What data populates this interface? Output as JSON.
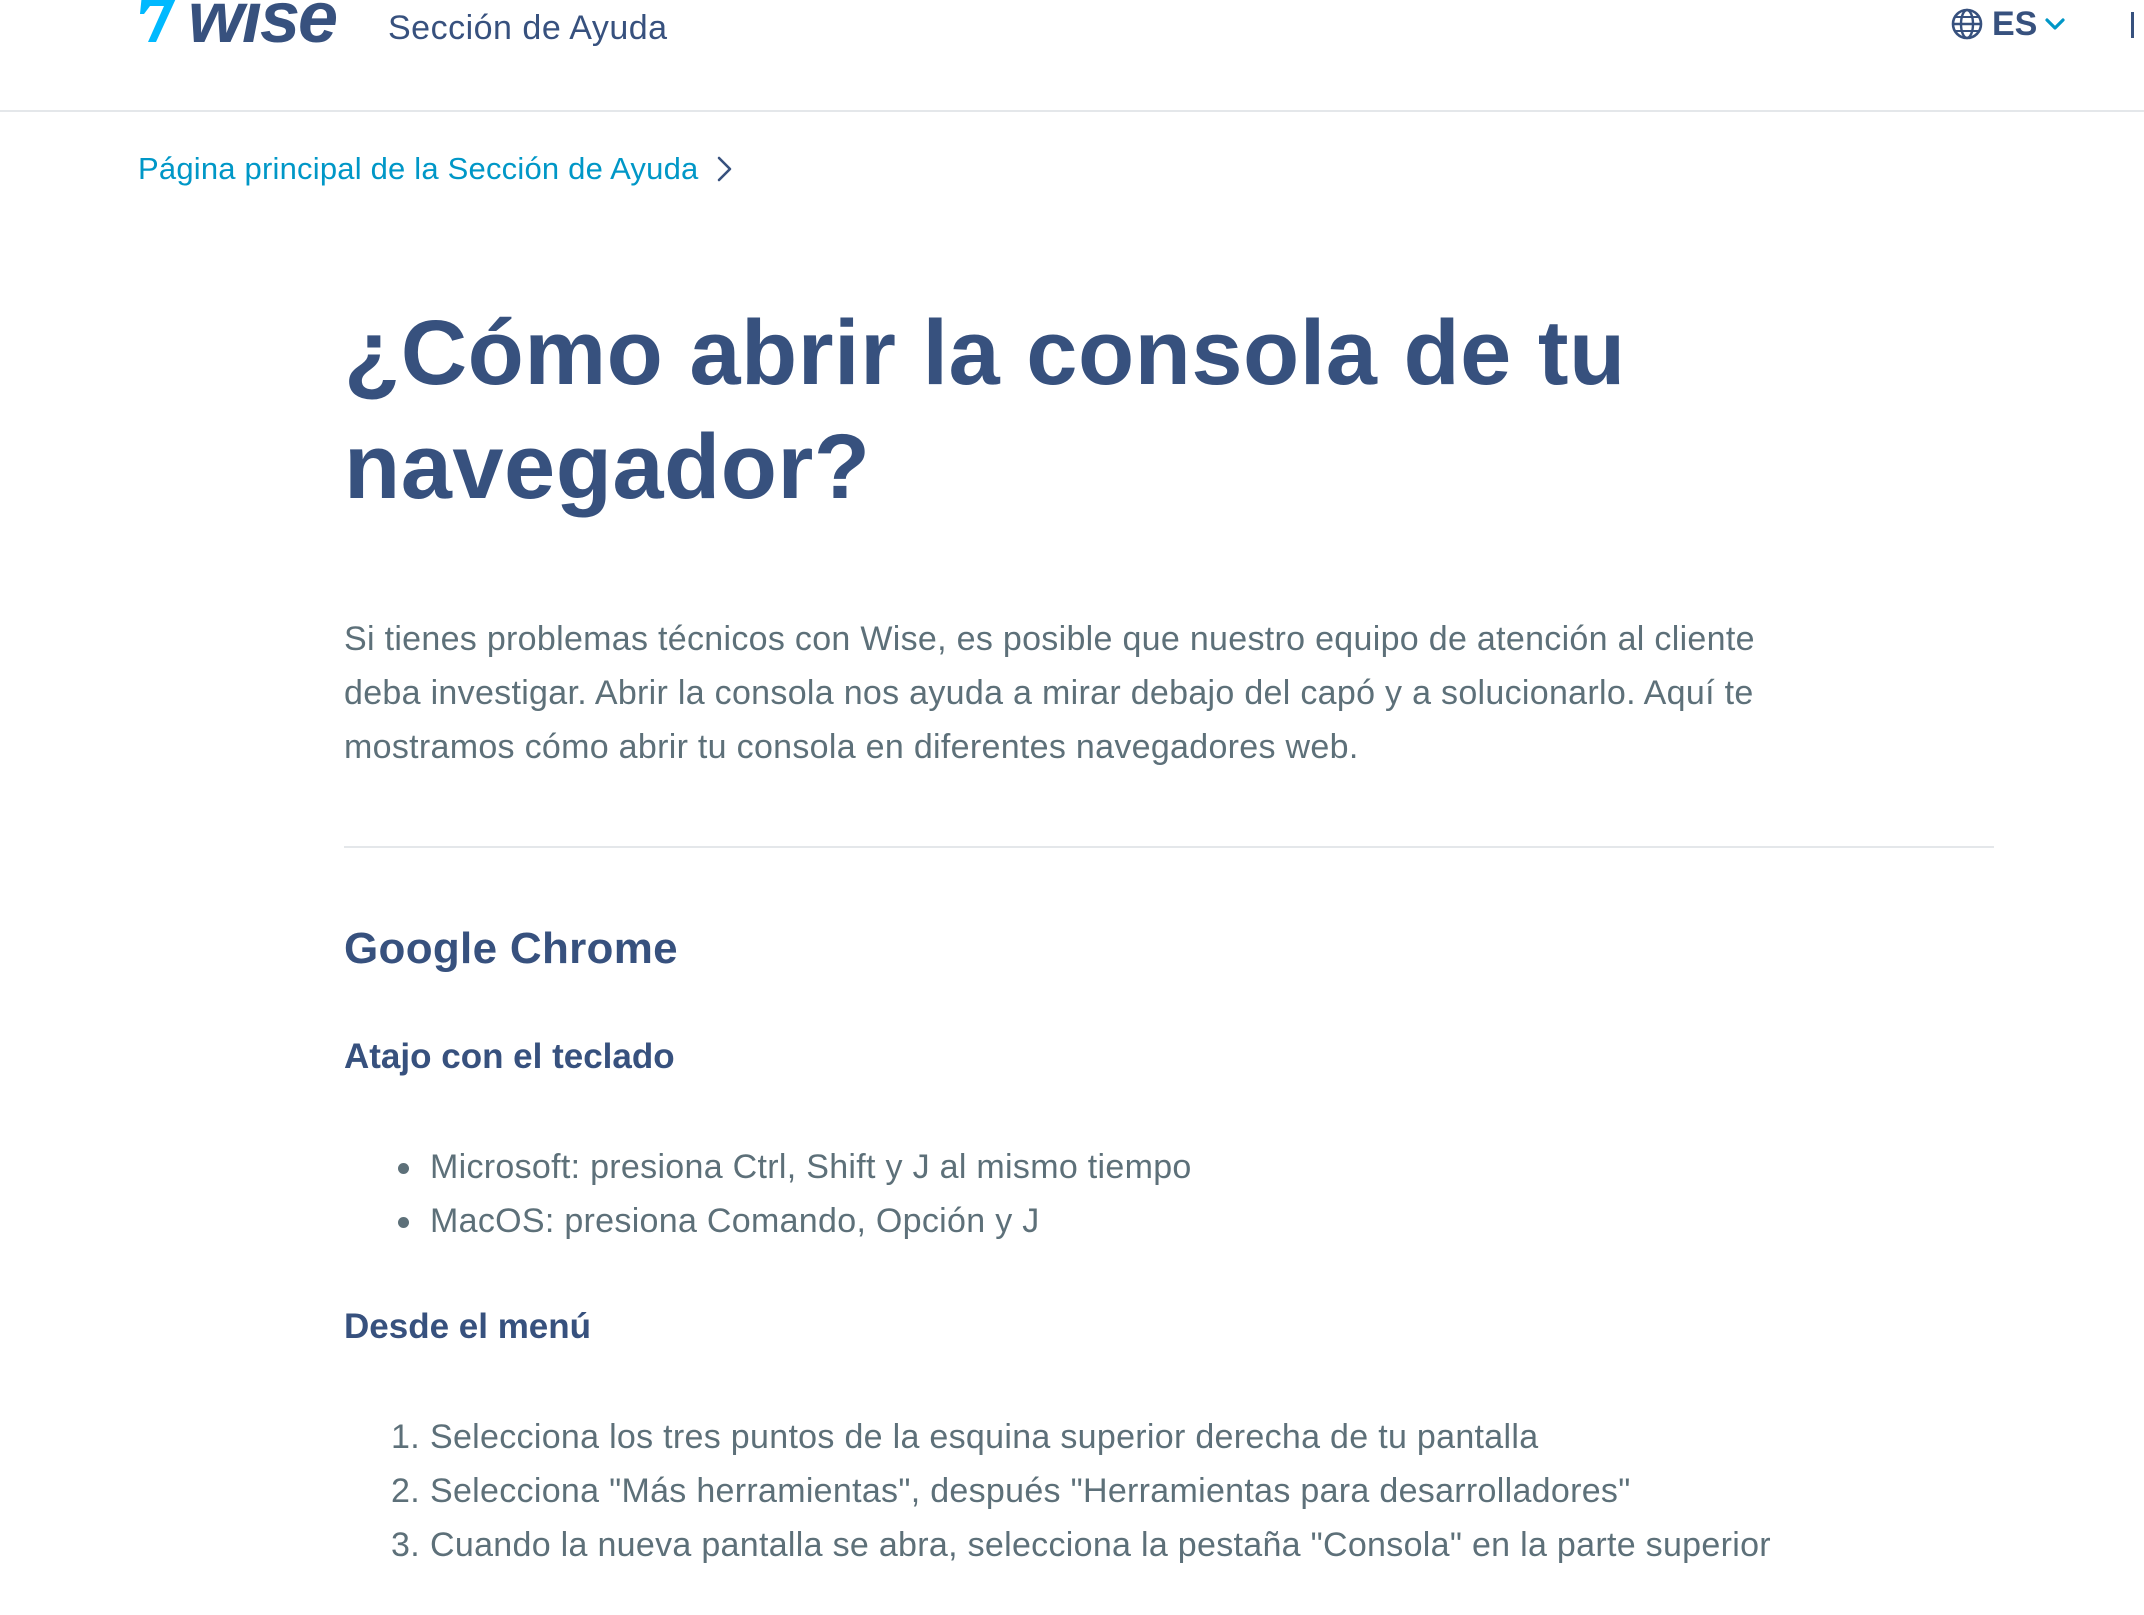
{
  "header": {
    "logo_text": "wise",
    "help_title": "Sección de Ayuda",
    "language": "ES"
  },
  "breadcrumb": {
    "link": "Página principal de la Sección de Ayuda"
  },
  "article": {
    "title": "¿Cómo abrir la consola de tu navegador?",
    "intro_lines": [
      "Si tienes problemas técnicos con Wise, es posible que nuestro equipo de atención al cliente",
      "deba investigar. Abrir la consola nos ayuda a mirar debajo del capó y a solucionarlo. Aquí te",
      "mostramos cómo abrir tu consola en diferentes navegadores web."
    ],
    "section_title": "Google Chrome",
    "keyboard_title": "Atajo con el teclado",
    "keyboard_items": [
      "Microsoft: presiona Ctrl, Shift y J al mismo tiempo",
      "MacOS: presiona Comando, Opción y J"
    ],
    "menu_title": "Desde el menú",
    "menu_steps": [
      {
        "num": "1.",
        "text": "Selecciona los tres puntos de la esquina superior derecha de tu pantalla"
      },
      {
        "num": "2.",
        "text": "Selecciona \"Más herramientas\", después \"Herramientas para desarrolladores\""
      },
      {
        "num": "3.",
        "text": "Cuando la nueva pantalla se abra, selecciona la pestaña \"Consola\" en la parte superior"
      }
    ]
  },
  "colors": {
    "navy": "#37517e",
    "link": "#0097c7",
    "body_text": "#5d7079",
    "logo_accent": "#00b9ff",
    "divider": "#e4e7ea"
  },
  "icons": [
    "wise-flag-icon",
    "globe-icon",
    "chevron-down-icon",
    "chevron-right-icon"
  ]
}
